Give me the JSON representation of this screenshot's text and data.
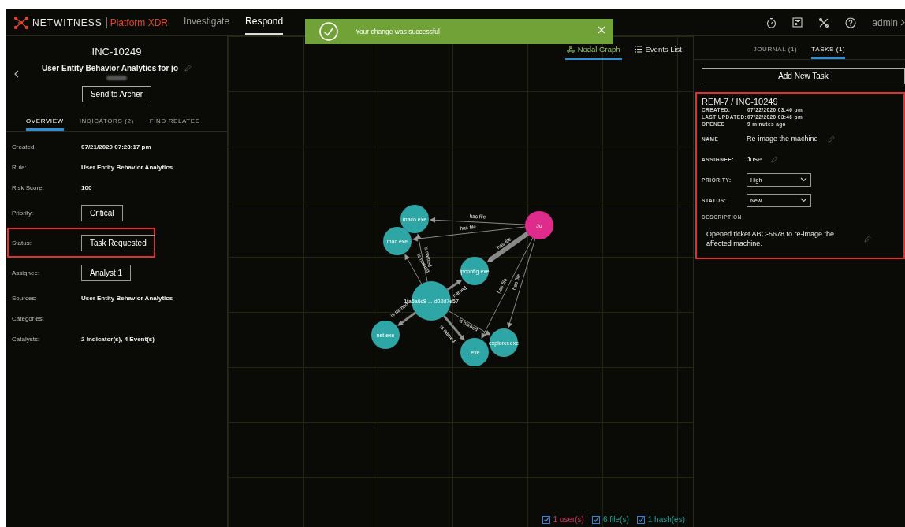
{
  "header": {
    "brand": "NETWITNESS",
    "product": "Platform XDR",
    "nav": [
      {
        "label": "Investigate",
        "selected": false
      },
      {
        "label": "Respond",
        "selected": true
      }
    ],
    "user": "admin"
  },
  "toast": {
    "message": "Your change was successful"
  },
  "incident": {
    "id": "INC-10249",
    "title": "User Entity Behavior Analytics for jo",
    "action": "Send to Archer",
    "tabs": [
      {
        "label": "OVERVIEW",
        "selected": true
      },
      {
        "label": "INDICATORS (2)",
        "selected": false
      },
      {
        "label": "FIND RELATED",
        "selected": false
      }
    ],
    "fields": [
      {
        "label": "Created:",
        "value": "07/21/2020 07:23:17 pm",
        "kind": "text",
        "highlighted": false
      },
      {
        "label": "Rule:",
        "value": "User Entity Behavior Analytics",
        "kind": "text",
        "highlighted": false
      },
      {
        "label": "Risk Score:",
        "value": "100",
        "kind": "text",
        "highlighted": false
      },
      {
        "label": "Priority:",
        "value": "Critical",
        "kind": "button",
        "highlighted": false
      },
      {
        "label": "Status:",
        "value": "Task Requested",
        "kind": "button",
        "highlighted": true
      },
      {
        "label": "Assignee:",
        "value": "Analyst 1",
        "kind": "button",
        "highlighted": false
      },
      {
        "label": "Sources:",
        "value": "User Entity Behavior Analytics",
        "kind": "text",
        "highlighted": false
      },
      {
        "label": "Categories:",
        "kind": "text",
        "highlighted": false
      },
      {
        "label": "Catalysts:",
        "value": "2 Indicator(s), 4 Event(s)",
        "kind": "text",
        "highlighted": false
      }
    ]
  },
  "graph": {
    "views": [
      {
        "label": "Nodal Graph",
        "selected": true
      },
      {
        "label": "Events List",
        "selected": false
      }
    ],
    "nodes": [
      {
        "label": "maco.exe",
        "color": "#2fa6a6"
      },
      {
        "label": "mac.exe",
        "color": "#2fa6a6"
      },
      {
        "label": "Jo",
        "color": "#de2b8c"
      },
      {
        "label": "ipconfig.exe",
        "color": "#2fa6a6"
      },
      {
        "label": "1fa5a6c8 ... d02d7e57",
        "color": "#2fa6a6"
      },
      {
        "label": "net.exe",
        "color": "#2fa6a6"
      },
      {
        "label": ".exe",
        "color": "#2fa6a6"
      },
      {
        "label": "explorer.exe",
        "color": "#2fa6a6"
      }
    ],
    "edges": [
      {
        "label": "has file"
      },
      {
        "label": "has file"
      },
      {
        "label": "has file"
      },
      {
        "label": "has file"
      },
      {
        "label": "has file"
      },
      {
        "label": "is named"
      },
      {
        "label": "is named"
      },
      {
        "label": "named"
      },
      {
        "label": "is named"
      },
      {
        "label": "is named"
      },
      {
        "label": "is named"
      }
    ],
    "legend": [
      {
        "label": "1 user(s)",
        "kind": "user",
        "checked": true
      },
      {
        "label": "6 file(s)",
        "kind": "file",
        "checked": true
      },
      {
        "label": "1 hash(es)",
        "kind": "hash",
        "checked": true
      }
    ]
  },
  "tasks_panel": {
    "tabs": [
      {
        "label": "JOURNAL (1)",
        "selected": false
      },
      {
        "label": "TASKS (1)",
        "selected": true
      }
    ],
    "add_button": "Add New Task",
    "task": {
      "title": "REM-7 / INC-10249",
      "highlighted": true,
      "meta": [
        {
          "label": "CREATED:",
          "value": "07/22/2020 03:46 pm"
        },
        {
          "label": "LAST UPDATED:",
          "value": "07/22/2020 03:46 pm"
        },
        {
          "label": "OPENED",
          "value": "9 minutes ago"
        }
      ],
      "fields": [
        {
          "label": "NAME",
          "value": "Re-image the machine",
          "kind": "editable"
        },
        {
          "label": "ASSIGNEE:",
          "value": "Jose",
          "kind": "editable"
        },
        {
          "label": "PRIORITY:",
          "value": "High",
          "kind": "select"
        },
        {
          "label": "STATUS:",
          "value": "New",
          "kind": "select"
        }
      ],
      "description_label": "DESCRIPTION",
      "description": "Opened ticket  ABC-5678 to re-image the affected machine."
    }
  }
}
